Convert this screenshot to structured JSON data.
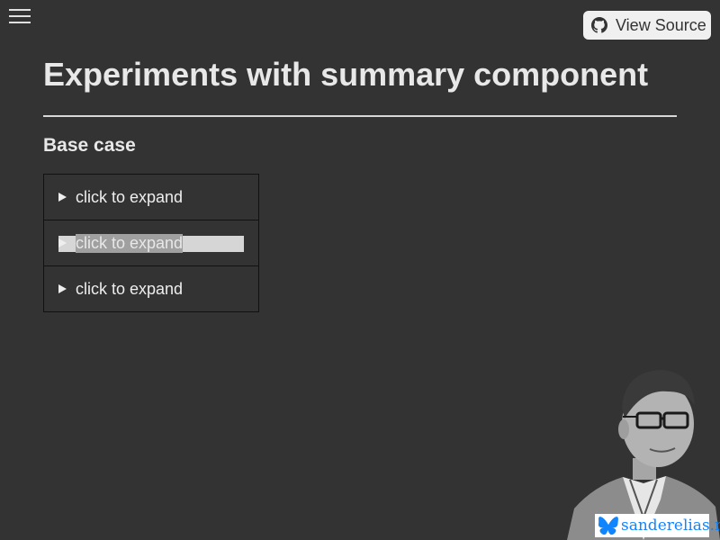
{
  "header": {
    "menu_icon": "hamburger-menu-icon",
    "view_source_label": "View Source",
    "view_source_icon": "github-icon"
  },
  "main": {
    "title": "Experiments with summary component",
    "section_heading": "Base case",
    "summaries": [
      {
        "label": "click to expand",
        "selected": false
      },
      {
        "label": "click to expand",
        "selected": true
      },
      {
        "label": "click to expand",
        "selected": false
      }
    ]
  },
  "footer": {
    "badge_text": "sanderelias.nl",
    "badge_icon": "butterfly-icon",
    "badge_color": "#1185fe",
    "portrait": "author-portrait"
  },
  "colors": {
    "background": "#333333",
    "text": "#eeeeee"
  }
}
